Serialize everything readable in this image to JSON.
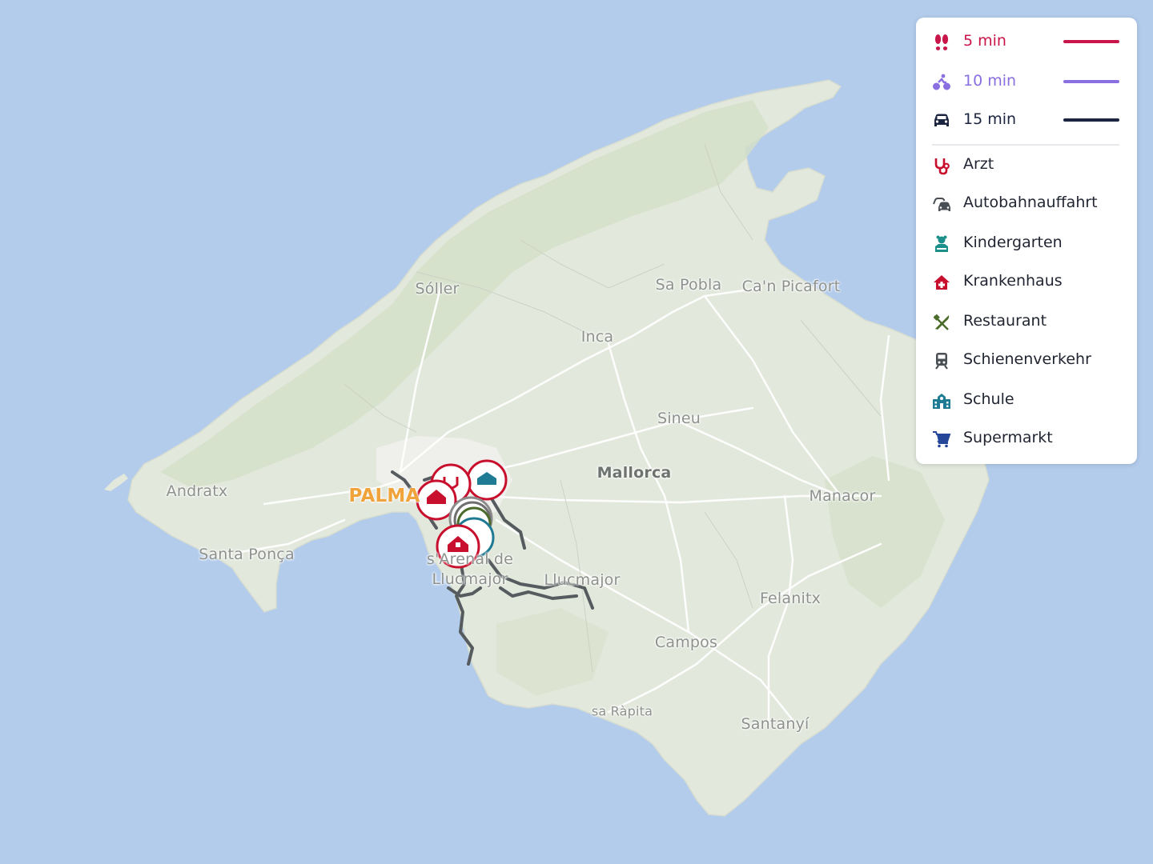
{
  "map": {
    "places": [
      {
        "name": "Sóller",
        "style": "normal"
      },
      {
        "name": "Sa Pobla",
        "style": "normal"
      },
      {
        "name": "Ca'n Picafort",
        "style": "normal"
      },
      {
        "name": "Inca",
        "style": "normal"
      },
      {
        "name": "Sineu",
        "style": "normal"
      },
      {
        "name": "Mallorca",
        "style": "big"
      },
      {
        "name": "Andratx",
        "style": "normal"
      },
      {
        "name": "PALMA",
        "style": "city"
      },
      {
        "name": "Manacor",
        "style": "normal"
      },
      {
        "name": "Santa Ponça",
        "style": "normal"
      },
      {
        "name": "s'Arenal de",
        "style": "normal"
      },
      {
        "name": "Llucmajor",
        "style": "normal"
      },
      {
        "name": "Llucmajor",
        "style": "normal"
      },
      {
        "name": "Felanitx",
        "style": "normal"
      },
      {
        "name": "Campos",
        "style": "normal"
      },
      {
        "name": "sa Ràpita",
        "style": "small"
      },
      {
        "name": "Santanyí",
        "style": "normal"
      }
    ],
    "colors": {
      "sea": "#b3ccec",
      "land": "#e3e8dc",
      "land_green": "#d3e0c8",
      "roads": "#ffffff",
      "isochrone": "#555b5e"
    }
  },
  "legend": {
    "travel_modes": [
      {
        "label": "5 min",
        "icon": "walking-icon",
        "color": "#c8164a"
      },
      {
        "label": "10 min",
        "icon": "bicycle-icon",
        "color": "#8a6fe0"
      },
      {
        "label": "15 min",
        "icon": "car-icon",
        "color": "#1c2540"
      }
    ],
    "categories": [
      {
        "label": "Arzt",
        "icon": "stethoscope-icon",
        "color": "#c8102e"
      },
      {
        "label": "Autobahnauffahrt",
        "icon": "highway-icon",
        "color": "#4a4f55"
      },
      {
        "label": "Kindergarten",
        "icon": "kindergarten-icon",
        "color": "#1b8f8a"
      },
      {
        "label": "Krankenhaus",
        "icon": "hospital-icon",
        "color": "#c8102e"
      },
      {
        "label": "Restaurant",
        "icon": "restaurant-icon",
        "color": "#4a6b2a"
      },
      {
        "label": "Schienenverkehr",
        "icon": "train-icon",
        "color": "#4a4f55"
      },
      {
        "label": "Schule",
        "icon": "school-icon",
        "color": "#1f7a93"
      },
      {
        "label": "Supermarkt",
        "icon": "cart-icon",
        "color": "#26469a"
      }
    ]
  }
}
